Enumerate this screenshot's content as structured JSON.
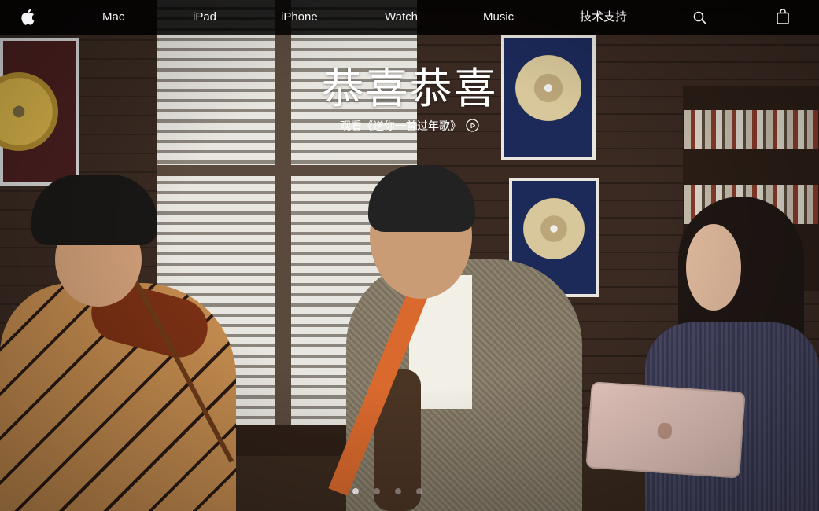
{
  "globalnav": {
    "apple_logo": "apple-logo-icon",
    "items": [
      {
        "label": "Mac"
      },
      {
        "label": "iPad"
      },
      {
        "label": "iPhone"
      },
      {
        "label": "Watch"
      },
      {
        "label": "Music"
      },
      {
        "label": "技术支持"
      }
    ],
    "search_icon": "search-icon",
    "bag_icon": "shopping-bag-icon"
  },
  "hero": {
    "headline": "恭喜恭喜",
    "cta_label": "观看《送你一首过年歌》",
    "cta_icon": "play-circle-icon"
  },
  "pagination": {
    "count": 4,
    "active_index": 0
  },
  "colors": {
    "nav_background": "#000000",
    "nav_text": "#f5f5f7",
    "hero_text": "#ffffff"
  }
}
